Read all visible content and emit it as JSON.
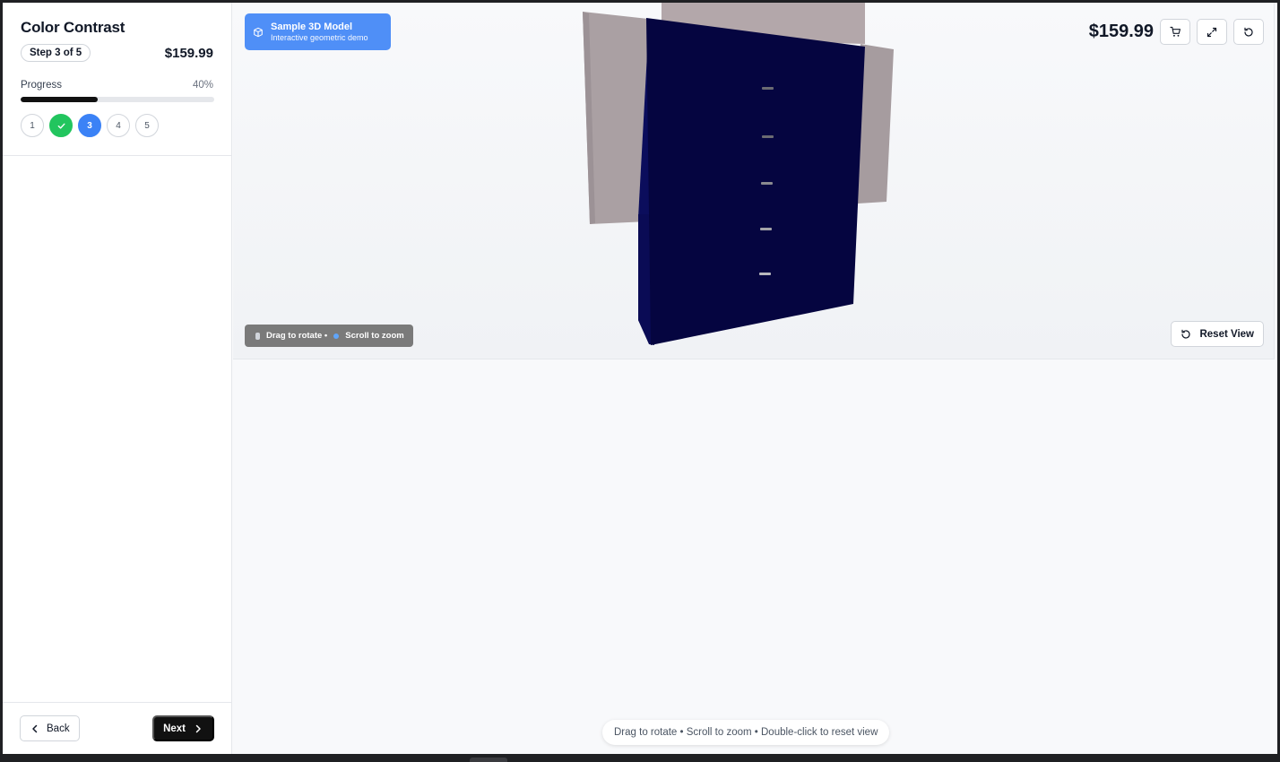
{
  "sidebar": {
    "title": "Color Contrast",
    "step_badge": "Step 3 of 5",
    "price": "$159.99",
    "progress_label": "Progress",
    "progress_percent": "40%",
    "progress_value": 0.4,
    "steps": [
      {
        "label": "1",
        "state": "pending"
      },
      {
        "label": "",
        "state": "done"
      },
      {
        "label": "3",
        "state": "current"
      },
      {
        "label": "4",
        "state": "pending"
      },
      {
        "label": "5",
        "state": "pending"
      }
    ],
    "back_label": "Back",
    "next_label": "Next"
  },
  "viewer": {
    "badge_title": "Sample 3D Model",
    "badge_subtitle": "Interactive geometric demo",
    "price": "$159.99",
    "hint_rotate": "Drag to rotate •",
    "hint_zoom": "Scroll to zoom",
    "reset_label": "Reset View",
    "bottom_hint": "Drag to rotate • Scroll to zoom • Double-click to reset view",
    "icons": [
      "cube-icon",
      "cart-icon",
      "expand-icon",
      "refresh-icon",
      "reset-icon"
    ]
  },
  "colors": {
    "accent_blue": "#3b82f6",
    "success_green": "#22c55e",
    "model_navy": "#050540",
    "model_panel": "#a89ea2"
  }
}
